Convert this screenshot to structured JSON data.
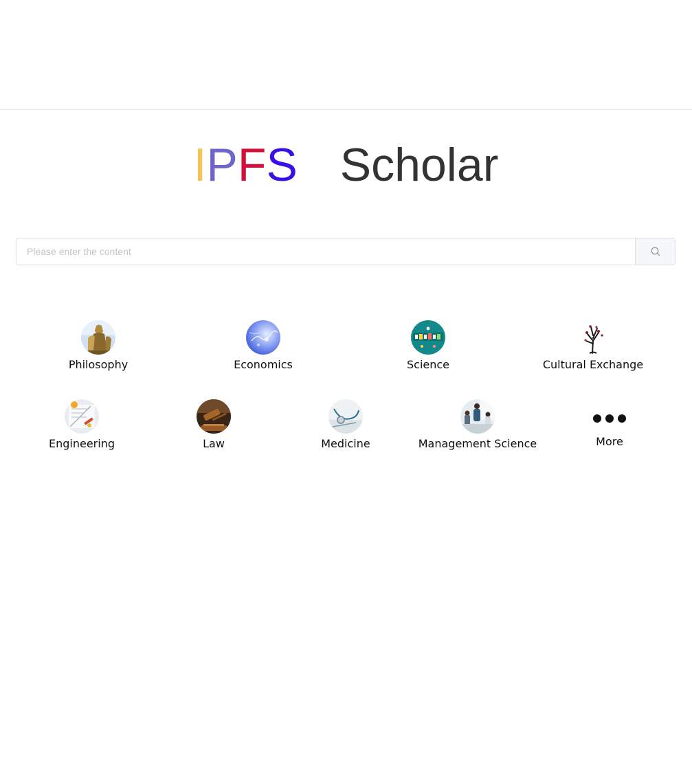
{
  "logo": {
    "letters": [
      {
        "char": "I",
        "color": "#f7c45a"
      },
      {
        "char": "P",
        "color": "#6f66cc"
      },
      {
        "char": "F",
        "color": "#d0103a"
      },
      {
        "char": "S",
        "color": "#3a10e8"
      }
    ],
    "word": "Scholar",
    "word_color": "#333333"
  },
  "search": {
    "placeholder": "Please enter the content",
    "value": "",
    "button_icon": "search-icon"
  },
  "categories": [
    {
      "label": "Philosophy",
      "icon": "philosophy-image"
    },
    {
      "label": "Economics",
      "icon": "economics-image"
    },
    {
      "label": "Science",
      "icon": "science-image"
    },
    {
      "label": "Cultural Exchange",
      "icon": "cultural-exchange-image"
    },
    {
      "label": "Engineering",
      "icon": "engineering-image"
    },
    {
      "label": "Law",
      "icon": "law-image"
    },
    {
      "label": "Medicine",
      "icon": "medicine-image"
    },
    {
      "label": "Management Science",
      "icon": "management-science-image"
    },
    {
      "label": "More",
      "icon": "more-dots-icon"
    }
  ]
}
